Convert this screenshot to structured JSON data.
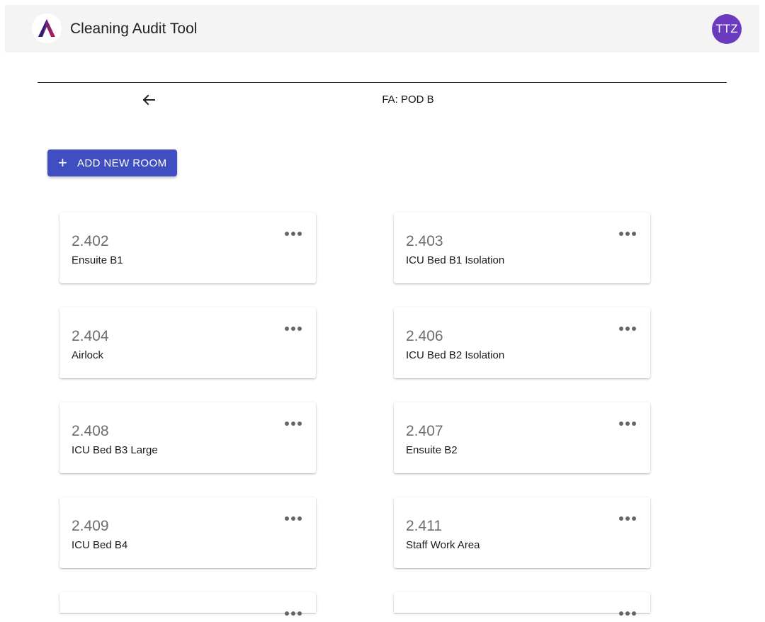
{
  "header": {
    "app_title": "Cleaning Audit Tool",
    "avatar_initials": "TTZ",
    "avatar_color": "#6a3bbf",
    "logo_icon": "brand-a-logo-icon"
  },
  "subheader": {
    "back_icon": "arrow-left-icon",
    "title": "FA: POD B"
  },
  "actions": {
    "add_room_label": "ADD NEW ROOM",
    "add_room_icon": "plus-icon",
    "button_color": "#3f4fc1"
  },
  "rooms": [
    {
      "number": "2.402",
      "name": "Ensuite B1"
    },
    {
      "number": "2.403",
      "name": "ICU Bed B1 Isolation"
    },
    {
      "number": "2.404",
      "name": "Airlock"
    },
    {
      "number": "2.406",
      "name": "ICU Bed B2 Isolation"
    },
    {
      "number": "2.408",
      "name": "ICU Bed B3 Large"
    },
    {
      "number": "2.407",
      "name": "Ensuite B2"
    },
    {
      "number": "2.409",
      "name": "ICU Bed B4"
    },
    {
      "number": "2.411",
      "name": "Staff Work Area"
    },
    {
      "number": "",
      "name": ""
    },
    {
      "number": "",
      "name": ""
    }
  ],
  "card_menu_icon": "more-horizontal-icon"
}
